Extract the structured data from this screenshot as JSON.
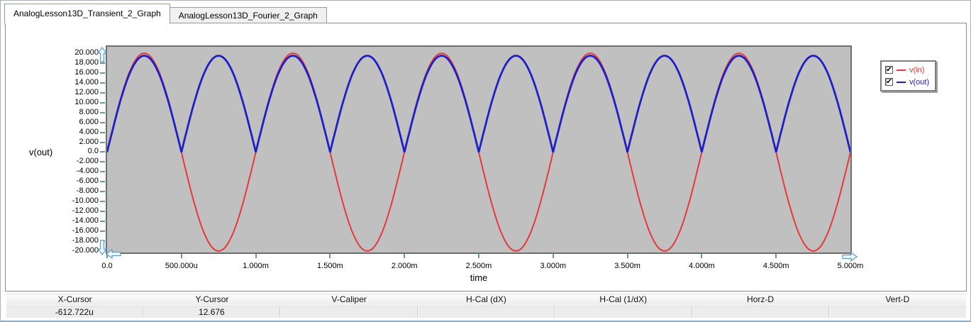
{
  "tabs": [
    {
      "label": "AnalogLesson13D_Transient_2_Graph",
      "active": true
    },
    {
      "label": "AnalogLesson13D_Fourier_2_Graph",
      "active": false
    }
  ],
  "plot": {
    "y_axis_title": "v(out)",
    "x_axis_title": "time",
    "background_color": "#c0c0c0",
    "tick_color": "#5f9ea0",
    "y_ticks": [
      {
        "label": "20.000",
        "value": 20
      },
      {
        "label": "18.000",
        "value": 18
      },
      {
        "label": "16.000",
        "value": 16
      },
      {
        "label": "14.000",
        "value": 14
      },
      {
        "label": "12.000",
        "value": 12
      },
      {
        "label": "10.000",
        "value": 10
      },
      {
        "label": "8.000",
        "value": 8
      },
      {
        "label": "6.000",
        "value": 6
      },
      {
        "label": "4.000",
        "value": 4
      },
      {
        "label": "2.000",
        "value": 2
      },
      {
        "label": "0.0",
        "value": 0
      },
      {
        "label": "-2.000",
        "value": -2
      },
      {
        "label": "-4.000",
        "value": -4
      },
      {
        "label": "-6.000",
        "value": -6
      },
      {
        "label": "-8.000",
        "value": -8
      },
      {
        "label": "-10.000",
        "value": -10
      },
      {
        "label": "-12.000",
        "value": -12
      },
      {
        "label": "-14.000",
        "value": -14
      },
      {
        "label": "-16.000",
        "value": -16
      },
      {
        "label": "-18.000",
        "value": -18
      },
      {
        "label": "-20.000",
        "value": -20
      }
    ],
    "x_ticks": [
      {
        "label": "0.0",
        "s": 0
      },
      {
        "label": "500.000u",
        "s": 0.0005
      },
      {
        "label": "1.000m",
        "s": 0.001
      },
      {
        "label": "1.500m",
        "s": 0.0015
      },
      {
        "label": "2.000m",
        "s": 0.002
      },
      {
        "label": "2.500m",
        "s": 0.0025
      },
      {
        "label": "3.000m",
        "s": 0.003
      },
      {
        "label": "3.500m",
        "s": 0.0035
      },
      {
        "label": "4.000m",
        "s": 0.004
      },
      {
        "label": "4.500m",
        "s": 0.0045
      },
      {
        "label": "5.000m",
        "s": 0.005
      }
    ],
    "scroll_arrows": [
      "up",
      "down",
      "left",
      "right"
    ]
  },
  "legend": {
    "items": [
      {
        "label": "v(in)",
        "color": "#e5393a",
        "checked": true,
        "check_glyph": "✔"
      },
      {
        "label": "v(out)",
        "color": "#1f1fc8",
        "checked": true,
        "check_glyph": "✔"
      }
    ]
  },
  "cursor_table": {
    "headers": [
      "X-Cursor",
      "Y-Cursor",
      "V-Caliper",
      "H-Cal (dX)",
      "H-Cal (1/dX)",
      "Horz-D",
      "Vert-D"
    ],
    "values": [
      "-612.722u",
      "12.676",
      "",
      "",
      "",
      "",
      ""
    ]
  },
  "chart_data": {
    "type": "line",
    "title": "",
    "xlabel": "time",
    "ylabel": "v(out)",
    "xlim_s": [
      0,
      0.005
    ],
    "ylim": [
      -20.3,
      21.3
    ],
    "y_tick_step": 2,
    "x_tick_step_s": 0.0005,
    "grid": false,
    "legend_position": "right",
    "series": [
      {
        "name": "v(in)",
        "color": "#e5393a",
        "waveform": "sine",
        "amplitude_v": 20.0,
        "frequency_hz": 1000,
        "phase_deg": 0,
        "stroke_width": 2
      },
      {
        "name": "v(out)",
        "color": "#1f1fc8",
        "waveform": "abs_sine",
        "amplitude_v": 19.5,
        "frequency_hz": 1000,
        "phase_deg": 0,
        "stroke_width": 2.8
      }
    ]
  }
}
